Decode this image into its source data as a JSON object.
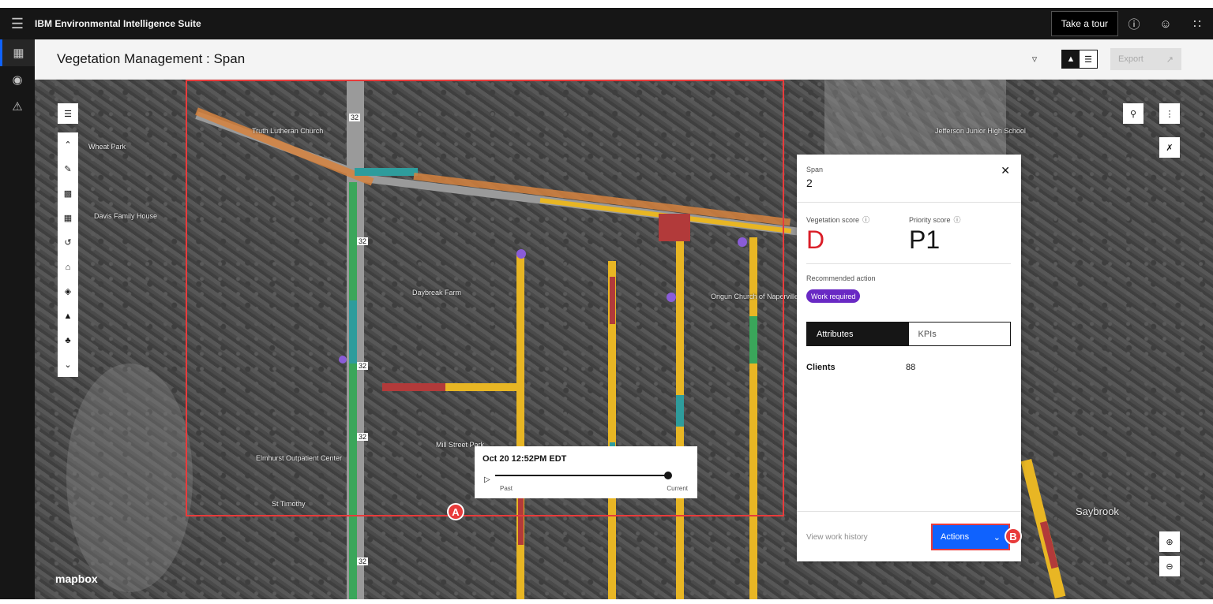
{
  "topbar": {
    "brand": "IBM Environmental Intelligence Suite",
    "tour_label": "Take a tour",
    "help_icon": "help-icon",
    "user_icon": "user-icon",
    "apps_icon": "app-switcher-icon"
  },
  "rail": {
    "items": [
      {
        "icon": "dashboard-icon"
      },
      {
        "icon": "globe-icon"
      },
      {
        "icon": "alert-icon"
      }
    ]
  },
  "header": {
    "title": "Vegetation Management : Span",
    "export_label": "Export"
  },
  "map": {
    "labels": {
      "church": "Truth Lutheran Church",
      "park1": "Wheat Park",
      "house": "Davis Family House",
      "farm": "Daybreak Farm",
      "church2": "Ongun Church of Naperville",
      "park2": "Mill Street Park",
      "center": "Elmhurst Outpatient Center",
      "timothy": "St Timothy",
      "school": "Jefferson Junior High School",
      "saybrook": "Saybrook",
      "route": "32"
    },
    "mapbox": "mapbox",
    "badge_a": "A",
    "badge_b": "B"
  },
  "timeline": {
    "date": "Oct 20 12:52PM EDT",
    "past": "Past",
    "current": "Current"
  },
  "panel": {
    "span_label": "Span",
    "span_value": "2",
    "veg_label": "Vegetation score",
    "veg_value": "D",
    "priority_label": "Priority score",
    "priority_value": "P1",
    "rec_label": "Recommended action",
    "rec_value": "Work required",
    "tab_attributes": "Attributes",
    "tab_kpis": "KPIs",
    "clients_label": "Clients",
    "clients_value": "88",
    "history": "View work history",
    "actions": "Actions"
  },
  "colors": {
    "accent": "#0f62fe",
    "score_red": "#da1e28",
    "highlight": "#e83b3b",
    "tag_purple": "#6929c4"
  }
}
